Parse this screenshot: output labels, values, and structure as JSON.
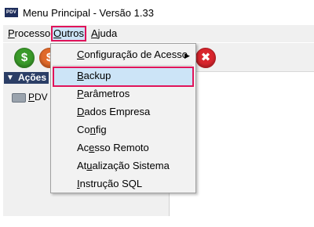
{
  "window": {
    "title": "Menu Principal - Versão 1.33",
    "app_icon_label": "PDV"
  },
  "menubar": {
    "items": [
      {
        "label": "Processo",
        "mnemonic": "P",
        "rest": "rocesso"
      },
      {
        "label": "Outros",
        "mnemonic": "O",
        "rest": "utros"
      },
      {
        "label": "Ajuda",
        "mnemonic": "A",
        "rest": "juda"
      }
    ]
  },
  "toolbar": {
    "buttons": [
      {
        "name": "money",
        "icon": "$",
        "color": "#3a9a2a"
      },
      {
        "name": "second",
        "icon": "$",
        "color": "#e0692a"
      },
      {
        "name": "close",
        "icon": "✖",
        "color": "#d8252d"
      }
    ]
  },
  "sidebar": {
    "header": "Ações",
    "items": [
      {
        "label": "PDV",
        "mnemonic": "P",
        "rest": "DV"
      }
    ]
  },
  "dropdown": {
    "items": [
      {
        "label": "Configuração de Acesso",
        "mnemonic": "C",
        "rest": "onfiguração de Acesso",
        "submenu": true
      },
      {
        "label": "Backup",
        "mnemonic": "B",
        "rest": "ackup",
        "highlighted": true
      },
      {
        "label": "Parâmetros",
        "mnemonic": "P",
        "rest": "arâmetros"
      },
      {
        "label": "Dados Empresa",
        "mnemonic": "D",
        "rest": "ados Empresa"
      },
      {
        "label": "Config",
        "pre": "Co",
        "mnemonic": "n",
        "rest": "fig"
      },
      {
        "label": "Acesso Remoto",
        "pre": "Ac",
        "mnemonic": "e",
        "rest": "sso Remoto"
      },
      {
        "label": "Atualização Sistema",
        "pre": "At",
        "mnemonic": "u",
        "rest": "alização Sistema"
      },
      {
        "label": "Instrução SQL",
        "mnemonic": "I",
        "rest": "nstrução SQL"
      }
    ]
  },
  "colors": {
    "highlight_outline": "#e0145a",
    "selection_fill": "#cce4f7",
    "sidebar_header": "#2b3e66"
  }
}
